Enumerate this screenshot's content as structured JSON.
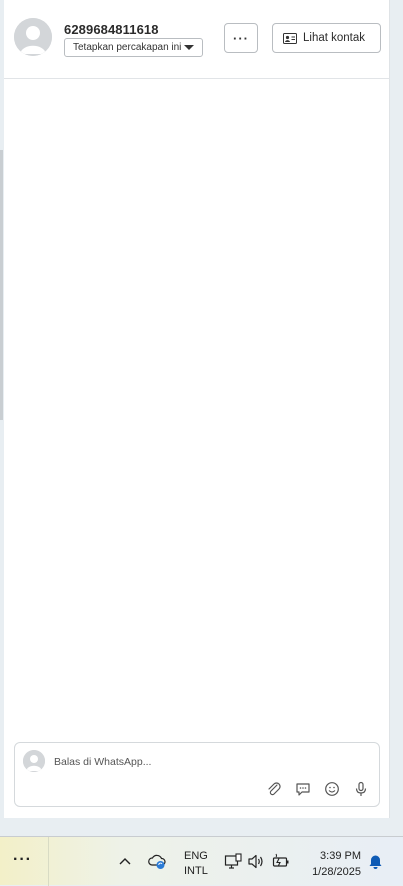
{
  "header": {
    "contact_name": "6289684811618",
    "pin_dropdown_label": "Tetapkan percakapan ini",
    "more_label": "···",
    "view_contact_label": "Lihat kontak"
  },
  "composer": {
    "placeholder": "Balas di WhatsApp..."
  },
  "taskbar": {
    "more_label": "···",
    "language_line1": "ENG",
    "language_line2": "INTL",
    "time": "3:39 PM",
    "date": "1/28/2025"
  },
  "icons": {
    "avatar": "person-silhouette-icon",
    "view_contact": "contact-card-icon",
    "attach": "paperclip-icon",
    "chat": "chat-bubble-icon",
    "emoji": "smiley-icon",
    "mic": "microphone-icon",
    "chevron": "chevron-up-icon",
    "sync": "cloud-sync-icon",
    "network": "network-icon",
    "volume": "speaker-icon",
    "battery": "battery-charging-icon",
    "bell": "notification-bell-icon"
  },
  "colors": {
    "panel_bg": "#ffffff",
    "app_bg": "#e8eef2",
    "border": "#b9bdc1",
    "bell": "#0f5bb5"
  }
}
